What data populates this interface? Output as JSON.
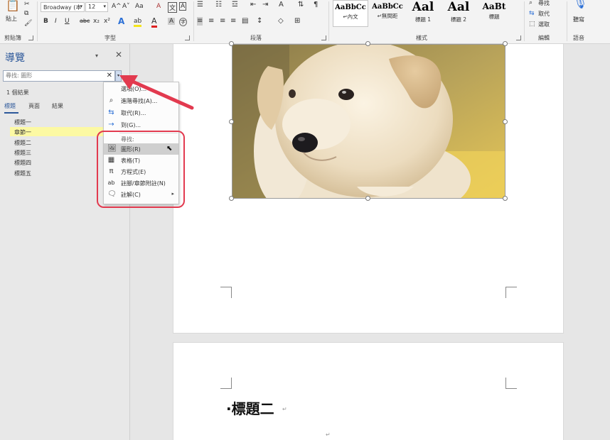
{
  "ribbon": {
    "clipboard": {
      "group_label": "剪貼簿",
      "paste_label": "貼上"
    },
    "font": {
      "group_label": "字型",
      "font_name": "Broadway (本",
      "font_size": "12",
      "bold": "B",
      "italic": "I",
      "underline": "U",
      "strike": "abc",
      "subscript": "x₂",
      "superscript": "x²",
      "text_effect": "A",
      "highlight": "ab",
      "font_color": "A",
      "grow": "A^",
      "shrink": "A˅",
      "case": "Aa",
      "clear": "A",
      "char_border": "A",
      "char_shading": "A",
      "enclose": "字"
    },
    "paragraph": {
      "group_label": "段落"
    },
    "styles": {
      "group_label": "樣式",
      "items": [
        {
          "preview": "AaBbCc",
          "name": "↵內文"
        },
        {
          "preview": "AaBbCc",
          "name": "↵無間距"
        },
        {
          "preview": "Aal",
          "name": "標題 1"
        },
        {
          "preview": "Aal",
          "name": "標題 2"
        },
        {
          "preview": "AaBt",
          "name": "標題"
        }
      ]
    },
    "editing": {
      "group_label": "編輯",
      "find": "尋找",
      "replace": "取代",
      "select": "選取"
    },
    "voice": {
      "group_label": "語音",
      "dictate": "聽寫"
    }
  },
  "nav": {
    "title": "導覽",
    "search_placeholder": "尋找: 圖形",
    "result_count": "1 個結果",
    "tabs": [
      "標題",
      "頁面",
      "結果"
    ],
    "headings": [
      "標題一",
      "章節一",
      "標題二",
      "標題三",
      "標題四",
      "標題五"
    ]
  },
  "menu": {
    "items": [
      {
        "label": "選項(O)...",
        "icon": "blank-icon"
      },
      {
        "label": "進階尋找(A)...",
        "icon": "magnifier-icon"
      },
      {
        "label": "取代(R)...",
        "icon": "replace-icon"
      },
      {
        "label": "到(G)...",
        "icon": "arrow-right-icon"
      }
    ],
    "find_group": "尋找:",
    "find_items": [
      {
        "label": "圖形(R)",
        "icon": "picture-icon"
      },
      {
        "label": "表格(T)",
        "icon": "table-icon"
      },
      {
        "label": "方程式(E)",
        "icon": "pi-icon"
      },
      {
        "label": "註腳/章節附註(N)",
        "icon": "footnote-icon"
      },
      {
        "label": "註解(C)",
        "icon": "comment-icon"
      }
    ]
  },
  "document": {
    "heading": "·標題二",
    "paragraph_mark": "↵"
  },
  "colors": {
    "accent": "#2b579a",
    "highlight": "#fcf9a3",
    "annotation_red": "#e23a4f"
  }
}
